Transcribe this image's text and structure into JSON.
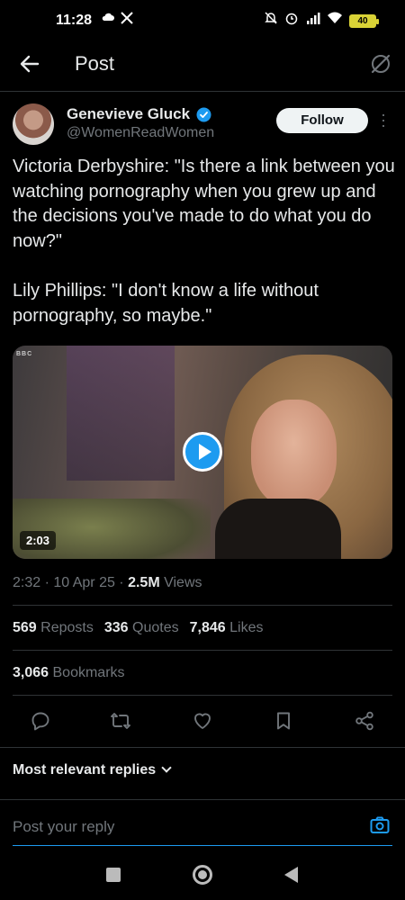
{
  "status_bar": {
    "time": "11:28",
    "left_icons": [
      "cloud-icon",
      "x-icon"
    ],
    "right_icons": [
      "mute-icon",
      "alarm-icon",
      "signal-icon",
      "wifi-icon",
      "battery-icon"
    ],
    "battery": "40"
  },
  "header": {
    "title": "Post",
    "back_icon": "arrow-left-icon",
    "right_icon": "grok-icon"
  },
  "author": {
    "name": "Genevieve Gluck",
    "handle": "@WomenReadWomen",
    "verified": true,
    "follow_label": "Follow"
  },
  "post": {
    "paragraph1": "Victoria Derbyshire: \"Is there a link between you watching pornography when you grew up and the decisions you've made to do what you do now?\"",
    "paragraph2": "Lily Phillips: \"I don't know a life without pornography, so maybe.\""
  },
  "video": {
    "duration": "2:03",
    "watermark": "BBC"
  },
  "meta": {
    "time": "2:32",
    "date": "10 Apr 25",
    "views_count": "2.5M",
    "views_label": "Views"
  },
  "stats": {
    "reposts_count": "569",
    "reposts_label": "Reposts",
    "quotes_count": "336",
    "quotes_label": "Quotes",
    "likes_count": "7,846",
    "likes_label": "Likes",
    "bookmarks_count": "3,066",
    "bookmarks_label": "Bookmarks"
  },
  "actions": [
    "reply-icon",
    "repost-icon",
    "like-icon",
    "bookmark-icon",
    "share-icon"
  ],
  "replies": {
    "sort_label": "Most relevant replies"
  },
  "reply_box": {
    "placeholder": "Post your reply"
  },
  "colors": {
    "background": "#000000",
    "text": "#e7e9ea",
    "secondary": "#71767b",
    "accent": "#1d9bf0",
    "divider": "#2f3336"
  }
}
